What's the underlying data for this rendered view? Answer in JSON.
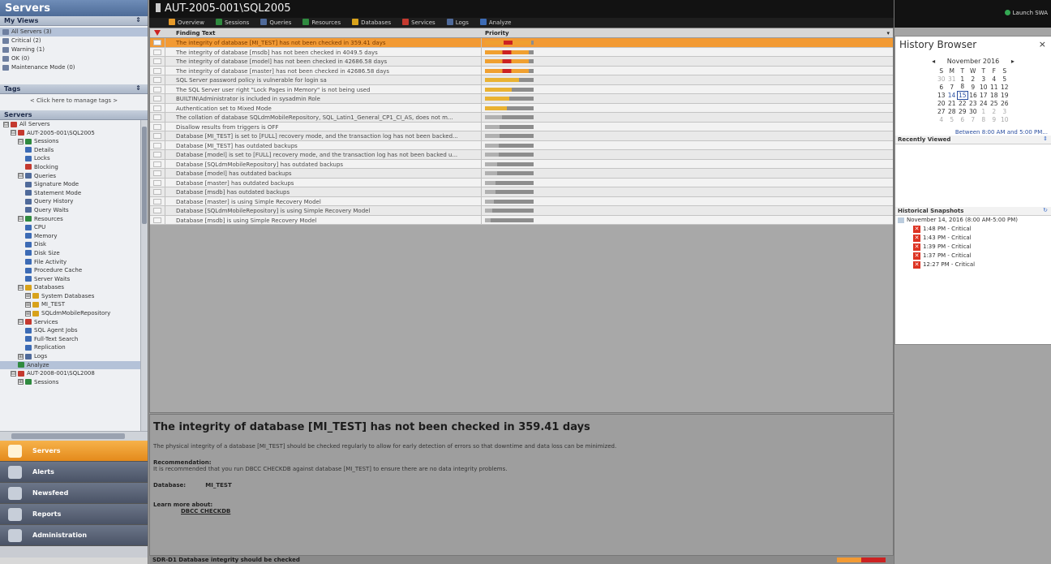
{
  "left": {
    "app_title": "Servers",
    "my_views_header": "My Views",
    "views": [
      "All Servers (3)",
      "Critical (2)",
      "Warning (1)",
      "OK (0)",
      "Maintenance Mode (0)"
    ],
    "tags_header": "Tags",
    "tags_hint": "< Click here to manage tags >",
    "servers_header": "Servers",
    "tree": [
      {
        "depth": 0,
        "label": "All Servers",
        "toggle": "⊟",
        "color": "#c4392f"
      },
      {
        "depth": 1,
        "label": "AUT-2005-001\\SQL2005",
        "toggle": "⊟",
        "color": "#c4392f"
      },
      {
        "depth": 2,
        "label": "Sessions",
        "toggle": "⊟",
        "color": "#2f8a3f"
      },
      {
        "depth": 3,
        "label": "Details",
        "toggle": "",
        "color": "#3c6bb5"
      },
      {
        "depth": 3,
        "label": "Locks",
        "toggle": "",
        "color": "#3c6bb5"
      },
      {
        "depth": 3,
        "label": "Blocking",
        "toggle": "",
        "color": "#c4392f"
      },
      {
        "depth": 2,
        "label": "Queries",
        "toggle": "⊟",
        "color": "#4f6a9a"
      },
      {
        "depth": 3,
        "label": "Signature Mode",
        "toggle": "",
        "color": "#4f6a9a"
      },
      {
        "depth": 3,
        "label": "Statement Mode",
        "toggle": "",
        "color": "#4f6a9a"
      },
      {
        "depth": 3,
        "label": "Query History",
        "toggle": "",
        "color": "#4f6a9a"
      },
      {
        "depth": 3,
        "label": "Query Waits",
        "toggle": "",
        "color": "#4f6a9a"
      },
      {
        "depth": 2,
        "label": "Resources",
        "toggle": "⊟",
        "color": "#2f8a3f"
      },
      {
        "depth": 3,
        "label": "CPU",
        "toggle": "",
        "color": "#3c6bb5"
      },
      {
        "depth": 3,
        "label": "Memory",
        "toggle": "",
        "color": "#3c6bb5"
      },
      {
        "depth": 3,
        "label": "Disk",
        "toggle": "",
        "color": "#3c6bb5"
      },
      {
        "depth": 3,
        "label": "Disk Size",
        "toggle": "",
        "color": "#3c6bb5"
      },
      {
        "depth": 3,
        "label": "File Activity",
        "toggle": "",
        "color": "#3c6bb5"
      },
      {
        "depth": 3,
        "label": "Procedure Cache",
        "toggle": "",
        "color": "#3c6bb5"
      },
      {
        "depth": 3,
        "label": "Server Waits",
        "toggle": "",
        "color": "#3c6bb5"
      },
      {
        "depth": 2,
        "label": "Databases",
        "toggle": "⊟",
        "color": "#d8a21a"
      },
      {
        "depth": 3,
        "label": "System Databases",
        "toggle": "⊞",
        "color": "#d8a21a"
      },
      {
        "depth": 3,
        "label": "MI_TEST",
        "toggle": "⊞",
        "color": "#d8a21a"
      },
      {
        "depth": 3,
        "label": "SQLdmMobileRepository",
        "toggle": "⊞",
        "color": "#d8a21a"
      },
      {
        "depth": 2,
        "label": "Services",
        "toggle": "⊟",
        "color": "#c4392f"
      },
      {
        "depth": 3,
        "label": "SQL Agent Jobs",
        "toggle": "",
        "color": "#3c6bb5"
      },
      {
        "depth": 3,
        "label": "Full-Text Search",
        "toggle": "",
        "color": "#3c6bb5"
      },
      {
        "depth": 3,
        "label": "Replication",
        "toggle": "",
        "color": "#3c6bb5"
      },
      {
        "depth": 2,
        "label": "Logs",
        "toggle": "⊞",
        "color": "#4f6a9a"
      },
      {
        "depth": 2,
        "label": "Analyze",
        "toggle": "",
        "color": "#2f8a3f",
        "selected": true
      },
      {
        "depth": 1,
        "label": "AUT-2008-001\\SQL2008",
        "toggle": "⊟",
        "color": "#c4392f"
      },
      {
        "depth": 2,
        "label": "Sessions",
        "toggle": "⊞",
        "color": "#2f8a3f"
      }
    ],
    "nav": [
      {
        "label": "Servers",
        "active": true
      },
      {
        "label": "Alerts",
        "active": false
      },
      {
        "label": "Newsfeed",
        "active": false
      },
      {
        "label": "Reports",
        "active": false
      },
      {
        "label": "Administration",
        "active": false
      }
    ]
  },
  "header": {
    "server_title": "AUT-2005-001\\SQL2005",
    "tabs": [
      {
        "label": "Overview",
        "color": "#e69a2a"
      },
      {
        "label": "Sessions",
        "color": "#2f8a3f"
      },
      {
        "label": "Queries",
        "color": "#4f6a9a"
      },
      {
        "label": "Resources",
        "color": "#2f8a3f"
      },
      {
        "label": "Databases",
        "color": "#d8a21a"
      },
      {
        "label": "Services",
        "color": "#c4392f"
      },
      {
        "label": "Logs",
        "color": "#4f6a9a"
      },
      {
        "label": "Analyze",
        "color": "#3c6bb5"
      }
    ]
  },
  "grid": {
    "col_finding": "Finding Text",
    "col_priority": "Priority",
    "rows": [
      {
        "text": "The integrity of database [MI_TEST] has not been checked in 359.41 days",
        "priority": 0.95,
        "selected": true
      },
      {
        "text": "The integrity of database [msdb] has not been checked in 4049.5 days",
        "priority": 0.9
      },
      {
        "text": "The integrity of database [model] has not been checked in 42686.58 days",
        "priority": 0.9
      },
      {
        "text": "The integrity of database [master] has not been checked in 42686.58 days",
        "priority": 0.9
      },
      {
        "text": "SQL Server password policy is vulnerable for login sa",
        "priority": 0.7
      },
      {
        "text": "The SQL Server user right \"Lock Pages in Memory\" is not being used",
        "priority": 0.55
      },
      {
        "text": "BUILTIN\\Administrator is included in sysadmin Role",
        "priority": 0.5
      },
      {
        "text": "Authentication set to Mixed Mode",
        "priority": 0.45
      },
      {
        "text": "The collation of database SQLdmMobileRepository, SQL_Latin1_General_CP1_CI_AS, does not m...",
        "priority": 0.35
      },
      {
        "text": "Disallow results from triggers is OFF",
        "priority": 0.3
      },
      {
        "text": "Database [MI_TEST] is set to [FULL] recovery mode, and the transaction log has not been backed...",
        "priority": 0.3
      },
      {
        "text": "Database [MI_TEST] has outdated backups",
        "priority": 0.28
      },
      {
        "text": "Database [model] is set to [FULL] recovery mode, and the transaction log has not been backed u...",
        "priority": 0.28
      },
      {
        "text": "Database [SQLdmMobileRepository] has outdated backups",
        "priority": 0.25
      },
      {
        "text": "Database [model] has outdated backups",
        "priority": 0.25
      },
      {
        "text": "Database [master] has outdated backups",
        "priority": 0.22
      },
      {
        "text": "Database [msdb] has outdated backups",
        "priority": 0.22
      },
      {
        "text": "Database [master] is using Simple Recovery Model",
        "priority": 0.18
      },
      {
        "text": "Database [SQLdmMobileRepository] is using Simple Recovery Model",
        "priority": 0.15
      },
      {
        "text": "Database [msdb] is using Simple Recovery Model",
        "priority": 0.12
      }
    ]
  },
  "detail": {
    "title": "The integrity of database [MI_TEST] has not been checked in 359.41 days",
    "description": "The physical integrity of a database [MI_TEST] should be checked regularly to allow for early detection of errors so that downtime and data loss can be minimized.",
    "rec_label": "Recommendation:",
    "rec_text": "It is recommended that you run DBCC CHECKDB against database [MI_TEST] to ensure there are no data integrity problems.",
    "db_label": "Database:",
    "db_value": "MI_TEST",
    "learn_label": "Learn more about:",
    "learn_link": "DBCC CHECKDB"
  },
  "status": {
    "text": "SDR-D1    Database integrity should be checked"
  },
  "right": {
    "launch": "Launch SWA",
    "hb_title": "History Browser",
    "close": "×",
    "month": "November 2016",
    "prev": "◂",
    "next": "▸",
    "dow": [
      "S",
      "M",
      "T",
      "W",
      "T",
      "F",
      "S"
    ],
    "weeks": [
      [
        "30",
        "31",
        "1",
        "2",
        "3",
        "4",
        "5"
      ],
      [
        "6",
        "7",
        "8",
        "9",
        "10",
        "11",
        "12"
      ],
      [
        "13",
        "14",
        "15",
        "16",
        "17",
        "18",
        "19"
      ],
      [
        "20",
        "21",
        "22",
        "23",
        "24",
        "25",
        "26"
      ],
      [
        "27",
        "28",
        "29",
        "30",
        "1",
        "2",
        "3"
      ],
      [
        "4",
        "5",
        "6",
        "7",
        "8",
        "9",
        "10"
      ]
    ],
    "between": "Between 8:00 AM and 5:00 PM...",
    "recent_header": "Recently Viewed",
    "snap_header": "Historical Snapshots",
    "snap_day": "November 14, 2016 (8:00 AM-5:00 PM)",
    "snapshots": [
      "1:48 PM - Critical",
      "1:43 PM - Critical",
      "1:39 PM - Critical",
      "1:37 PM - Critical",
      "12:27 PM - Critical"
    ]
  },
  "colors": {
    "accent_orange": "#f29a34",
    "critical_red": "#cc2222",
    "link_blue": "#2b4fa0"
  }
}
